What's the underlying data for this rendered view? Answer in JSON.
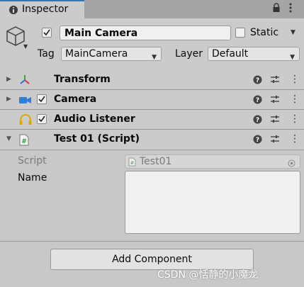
{
  "tab": {
    "title": "Inspector",
    "icon": "info-icon"
  },
  "window_controls": {
    "lock_icon": "lock-icon",
    "menu_icon": "more-vertical-icon"
  },
  "header": {
    "active": true,
    "name": "Main Camera",
    "static_label": "Static",
    "static_checked": false,
    "tag_label": "Tag",
    "tag_value": "MainCamera",
    "layer_label": "Layer",
    "layer_value": "Default"
  },
  "components": [
    {
      "title": "Transform",
      "icon": "transform-icon",
      "expanded": false,
      "has_checkbox": false
    },
    {
      "title": "Camera",
      "icon": "camera-icon",
      "expanded": false,
      "has_checkbox": true,
      "enabled": true
    },
    {
      "title": "Audio Listener",
      "icon": "headphones-icon",
      "expanded": false,
      "has_checkbox": true,
      "enabled": true
    },
    {
      "title": "Test 01 (Script)",
      "icon": "script-icon",
      "expanded": true,
      "has_checkbox": false
    }
  ],
  "script_component": {
    "script_label": "Script",
    "script_value": "Test01",
    "name_label": "Name",
    "name_value": ""
  },
  "add_component_label": "Add Component",
  "watermark": "CSDN @恬静的小魔龙",
  "colors": {
    "accent": "#3a72b0",
    "panel": "#c8c8c8",
    "header": "#cbcbcb"
  }
}
